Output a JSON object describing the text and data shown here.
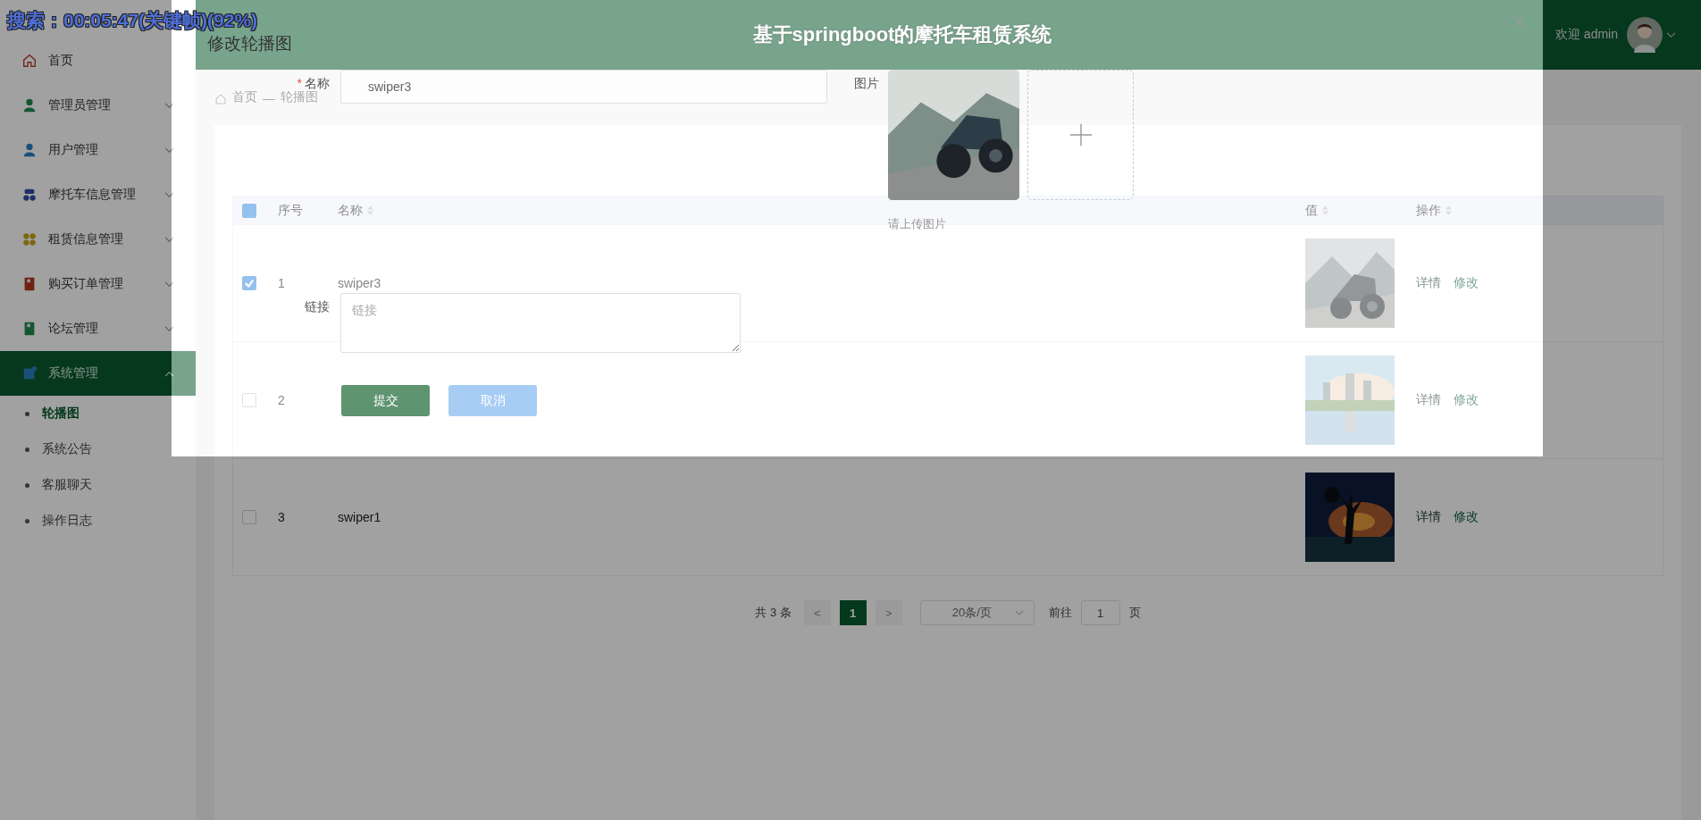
{
  "video_overlay": "搜索：00:05:47(关键帧)(92%)",
  "header": {
    "title": "基于springboot的摩托车租赁系统",
    "welcome": "欢迎 admin"
  },
  "sidebar": {
    "items": [
      {
        "label": "首页",
        "kind": "link",
        "selected": false
      },
      {
        "label": "管理员管理",
        "kind": "menu",
        "selected": false,
        "expanded": false
      },
      {
        "label": "用户管理",
        "kind": "menu",
        "selected": false,
        "expanded": false
      },
      {
        "label": "摩托车信息管理",
        "kind": "menu",
        "selected": false,
        "expanded": false
      },
      {
        "label": "租赁信息管理",
        "kind": "menu",
        "selected": false,
        "expanded": false
      },
      {
        "label": "购买订单管理",
        "kind": "menu",
        "selected": false,
        "expanded": false
      },
      {
        "label": "论坛管理",
        "kind": "menu",
        "selected": false,
        "expanded": false
      },
      {
        "label": "系统管理",
        "kind": "menu",
        "selected": true,
        "expanded": true,
        "children": [
          {
            "label": "轮播图",
            "selected": true
          },
          {
            "label": "系统公告",
            "selected": false
          },
          {
            "label": "客服聊天",
            "selected": false
          },
          {
            "label": "操作日志",
            "selected": false
          }
        ]
      }
    ]
  },
  "breadcrumb": [
    "首页",
    "—",
    "轮播图"
  ],
  "table": {
    "select_all_indeterminate": true,
    "columns": [
      "序号",
      "名称",
      "值",
      "操作"
    ],
    "rows": [
      {
        "checked": true,
        "index": "1",
        "name": "swiper3",
        "actions": [
          "详情",
          "修改"
        ]
      },
      {
        "checked": false,
        "index": "2",
        "actions": [
          "详情",
          "修改"
        ]
      },
      {
        "checked": false,
        "index": "3",
        "name": "swiper1",
        "actions": [
          "详情",
          "修改"
        ]
      }
    ]
  },
  "pagination": {
    "total": "共 3 条",
    "prev": "<",
    "pages": [
      {
        "label": "1",
        "selected": true
      }
    ],
    "next": ">",
    "page_size": "20条/页",
    "goto_label": "前往",
    "goto_value": "1",
    "goto_suffix": "页"
  },
  "dialog": {
    "title": "修改轮播图",
    "name_label": "名称",
    "name_required_mark": "*",
    "name_value": "swiper3",
    "image_label": "图片",
    "image_hint": "请上传图片",
    "link_label": "链接",
    "link_placeholder": "链接",
    "submit": "提交",
    "cancel": "取消"
  }
}
